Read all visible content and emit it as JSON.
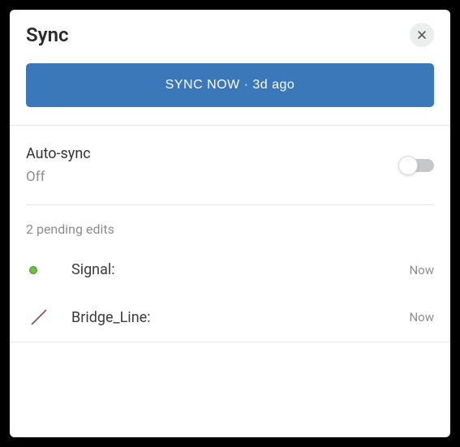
{
  "header": {
    "title": "Sync"
  },
  "syncButton": {
    "label": "SYNC NOW · 3d ago"
  },
  "autoSync": {
    "title": "Auto-sync",
    "status": "Off",
    "enabled": false
  },
  "pending": {
    "label": "2 pending edits",
    "items": [
      {
        "name": "Signal:",
        "time": "Now",
        "iconType": "dot",
        "iconColor": "#6fbf44"
      },
      {
        "name": "Bridge_Line:",
        "time": "Now",
        "iconType": "line",
        "iconColor": "#97464a"
      }
    ]
  }
}
